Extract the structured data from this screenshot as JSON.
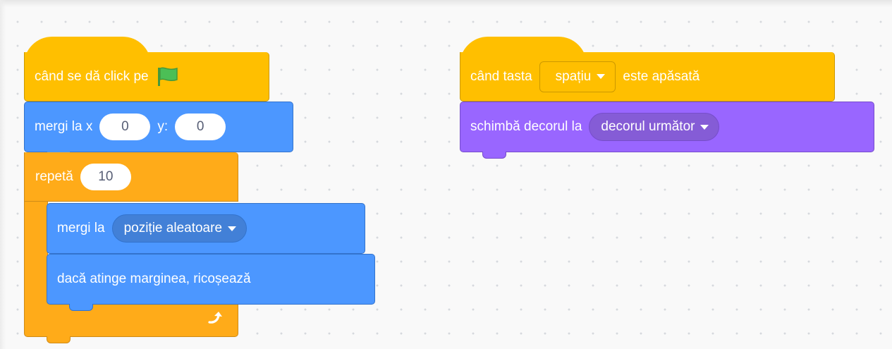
{
  "colors": {
    "events": "#ffbf00",
    "motion": "#4c97ff",
    "control": "#ffab19",
    "looks": "#9966ff",
    "workspace": "#f9f9f9"
  },
  "script1": {
    "when_flag_label": "când se dă click pe",
    "flag_icon": "green-flag-icon",
    "goto_xy": {
      "label": "mergi la x",
      "x_value": "0",
      "y_label": "y:",
      "y_value": "0"
    },
    "repeat": {
      "label": "repetă",
      "count": "10",
      "loop_icon": "loop-arrow-icon"
    },
    "goto_target": {
      "label": "mergi la",
      "option": "poziție aleatoare"
    },
    "bounce": {
      "label": "dacă atinge marginea, ricoșează"
    }
  },
  "script2": {
    "when_key_label": "când tasta",
    "key_option": "spațiu",
    "when_key_suffix": "este apăsată",
    "switch_backdrop": {
      "label": "schimbă decorul la",
      "option": "decorul următor"
    }
  }
}
